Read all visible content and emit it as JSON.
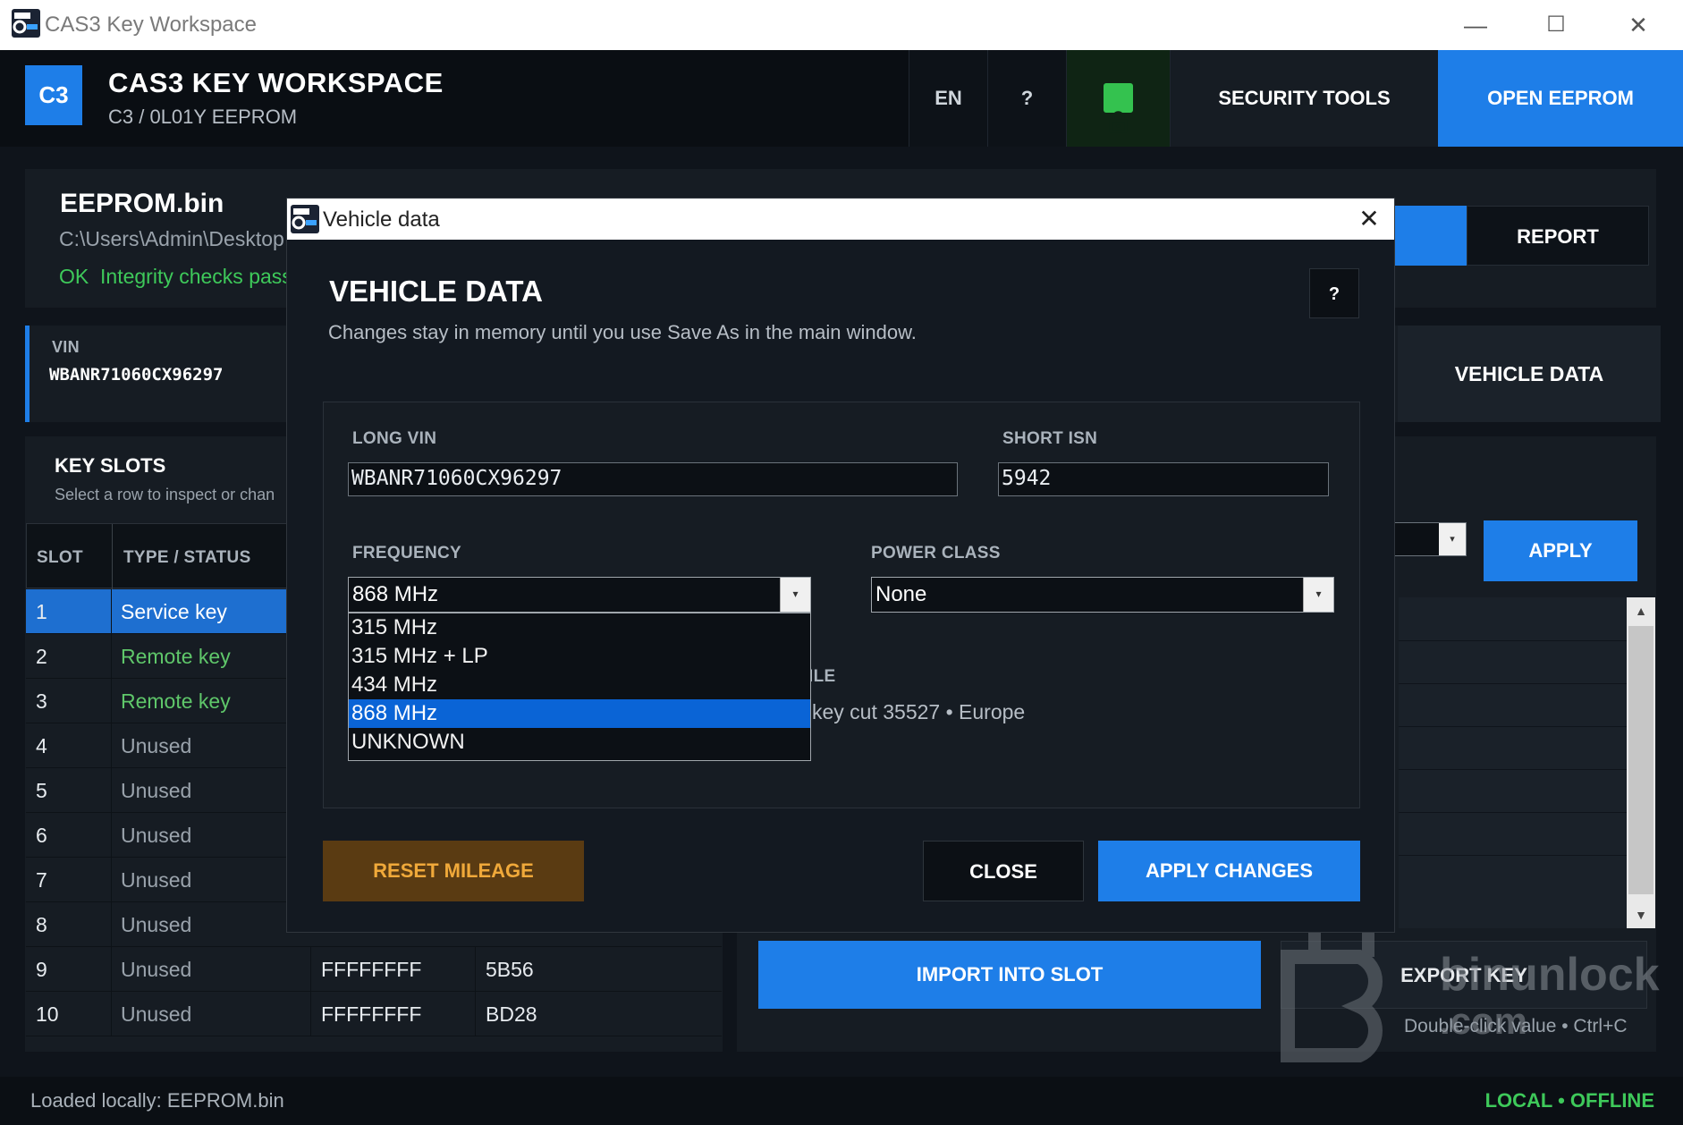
{
  "window": {
    "title": "CAS3 Key Workspace",
    "minimize_glyph": "—",
    "maximize_glyph": "☐",
    "close_glyph": "✕"
  },
  "header": {
    "badge": "C3",
    "title": "CAS3 KEY WORKSPACE",
    "subtitle": "C3 / 0L01Y EEPROM",
    "lang_button": "EN",
    "help_button": "?",
    "security_tools": "SECURITY TOOLS",
    "open_eeprom": "OPEN EEPROM"
  },
  "file_card": {
    "filename": "EEPROM.bin",
    "path": "C:\\Users\\Admin\\Desktop",
    "status_ok": "OK",
    "status_text": "Integrity checks pass",
    "report_button": "REPORT"
  },
  "vin_card": {
    "label": "VIN",
    "value": "WBANR71060CX96297",
    "vehicle_data_button": "VEHICLE DATA"
  },
  "key_slots": {
    "title": "KEY SLOTS",
    "hint": "Select a row to inspect or chan",
    "columns": [
      "SLOT",
      "TYPE / STATUS"
    ],
    "rows": [
      {
        "slot": "1",
        "type": "Service key",
        "c3": "",
        "c4": ""
      },
      {
        "slot": "2",
        "type": "Remote key",
        "c3": "",
        "c4": ""
      },
      {
        "slot": "3",
        "type": "Remote key",
        "c3": "",
        "c4": ""
      },
      {
        "slot": "4",
        "type": "Unused",
        "c3": "",
        "c4": ""
      },
      {
        "slot": "5",
        "type": "Unused",
        "c3": "",
        "c4": ""
      },
      {
        "slot": "6",
        "type": "Unused",
        "c3": "",
        "c4": ""
      },
      {
        "slot": "7",
        "type": "Unused",
        "c3": "",
        "c4": ""
      },
      {
        "slot": "8",
        "type": "Unused",
        "c3": "",
        "c4": ""
      },
      {
        "slot": "9",
        "type": "Unused",
        "c3": "FFFFFFFF",
        "c4": "5B56"
      },
      {
        "slot": "10",
        "type": "Unused",
        "c3": "FFFFFFFF",
        "c4": "BD28"
      }
    ]
  },
  "right_panel": {
    "apply_button": "APPLY",
    "import_button": "IMPORT INTO SLOT",
    "export_button": "EXPORT KEY",
    "hint": "Double-click value • Ctrl+C"
  },
  "status_bar": {
    "left": "Loaded locally: EEPROM.bin",
    "right": "LOCAL • OFFLINE"
  },
  "watermark": {
    "text_top": "binunlock",
    "text_bottom": ".com"
  },
  "dialog": {
    "window_title": "Vehicle data",
    "close_glyph": "✕",
    "heading": "VEHICLE DATA",
    "help_button": "?",
    "description": "Changes stay in memory until you use Save As in the main window.",
    "long_vin_label": "LONG VIN",
    "long_vin_value": "WBANR71060CX96297",
    "short_isn_label": "SHORT ISN",
    "short_isn_value": "5942",
    "frequency_label": "FREQUENCY",
    "frequency_value": "868 MHz",
    "frequency_options": [
      "315 MHz",
      "315 MHz + LP",
      "434 MHz",
      "868 MHz",
      "UNKNOWN"
    ],
    "frequency_selected_index": 3,
    "power_class_label": "POWER CLASS",
    "power_class_value": "None",
    "profile_label_partial": "ILE",
    "profile_text": "key cut 35527  •  Europe",
    "reset_mileage": "RESET MILEAGE",
    "close_button": "CLOSE",
    "apply_changes": "APPLY CHANGES"
  },
  "colors": {
    "accent": "#1e7ee8",
    "ok_green": "#3ec95a",
    "remote_green": "#5fc76a",
    "reset_bg": "#5a3b12",
    "reset_text": "#f0a93a",
    "dropdown_selected": "#0a64d6"
  }
}
